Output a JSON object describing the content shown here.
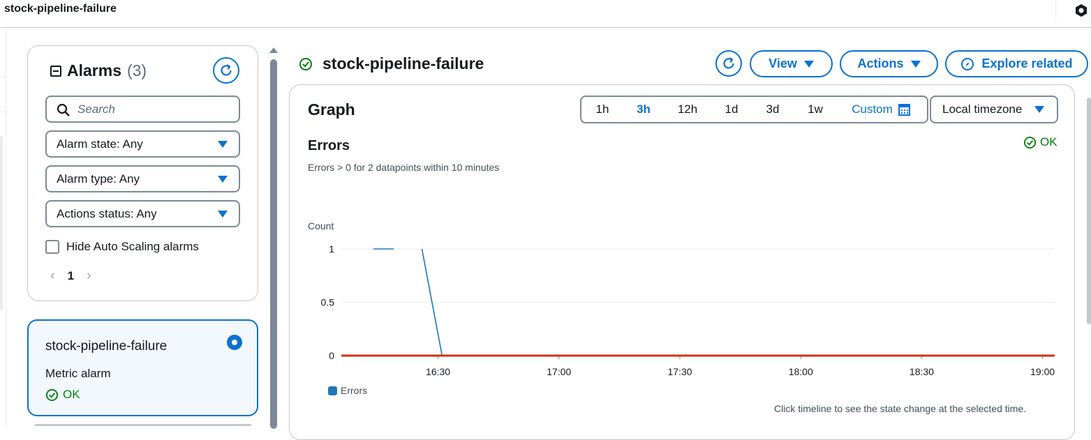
{
  "window": {
    "title": "stock-pipeline-failure",
    "extension_icon": "hexagon-icon"
  },
  "alarms": {
    "title": "Alarms",
    "count": "(3)",
    "search_placeholder": "Search",
    "filters": [
      {
        "label": "Alarm state: Any"
      },
      {
        "label": "Alarm type: Any"
      },
      {
        "label": "Actions status: Any"
      }
    ],
    "hide_autoscaling_label": "Hide Auto Scaling alarms",
    "hide_autoscaling_checked": false,
    "page": "1"
  },
  "selected_alarm": {
    "name": "stock-pipeline-failure",
    "type": "Metric alarm",
    "state": "OK"
  },
  "main": {
    "title": "stock-pipeline-failure",
    "view_label": "View",
    "actions_label": "Actions",
    "explore_label": "Explore related"
  },
  "graph": {
    "title": "Graph",
    "ranges": [
      "1h",
      "3h",
      "12h",
      "1d",
      "3d",
      "1w"
    ],
    "active_range": "3h",
    "custom_label": "Custom",
    "timezone_label": "Local timezone",
    "metric_title": "Errors",
    "metric_description": "Errors > 0 for 2 datapoints within 10 minutes",
    "metric_state": "OK",
    "footnote": "Click timeline to see the state change at the selected time."
  },
  "colors": {
    "accent": "#0972d3",
    "ok": "#037f0c",
    "series": "#1f77b4",
    "threshold": "#d13212"
  },
  "chart_data": {
    "type": "line",
    "ylabel": "Count",
    "ylim": [
      0,
      1
    ],
    "yticks": [
      "1",
      "0.5",
      "0"
    ],
    "ytick_values": [
      1,
      0.5,
      0
    ],
    "xticks": [
      "16:30",
      "17:00",
      "17:30",
      "18:00",
      "18:30",
      "19:00"
    ],
    "xtick_minutes": [
      990,
      1020,
      1050,
      1080,
      1110,
      1140
    ],
    "xlim_minutes": [
      966,
      1143
    ],
    "series": [
      {
        "name": "Errors",
        "points": [
          [
            974,
            1
          ],
          [
            979,
            1
          ]
        ]
      },
      {
        "name": "Errors",
        "points": [
          [
            986,
            1
          ],
          [
            991,
            0
          ]
        ]
      }
    ],
    "threshold": {
      "value": 0
    },
    "legend": [
      "Errors"
    ],
    "grid": true
  }
}
